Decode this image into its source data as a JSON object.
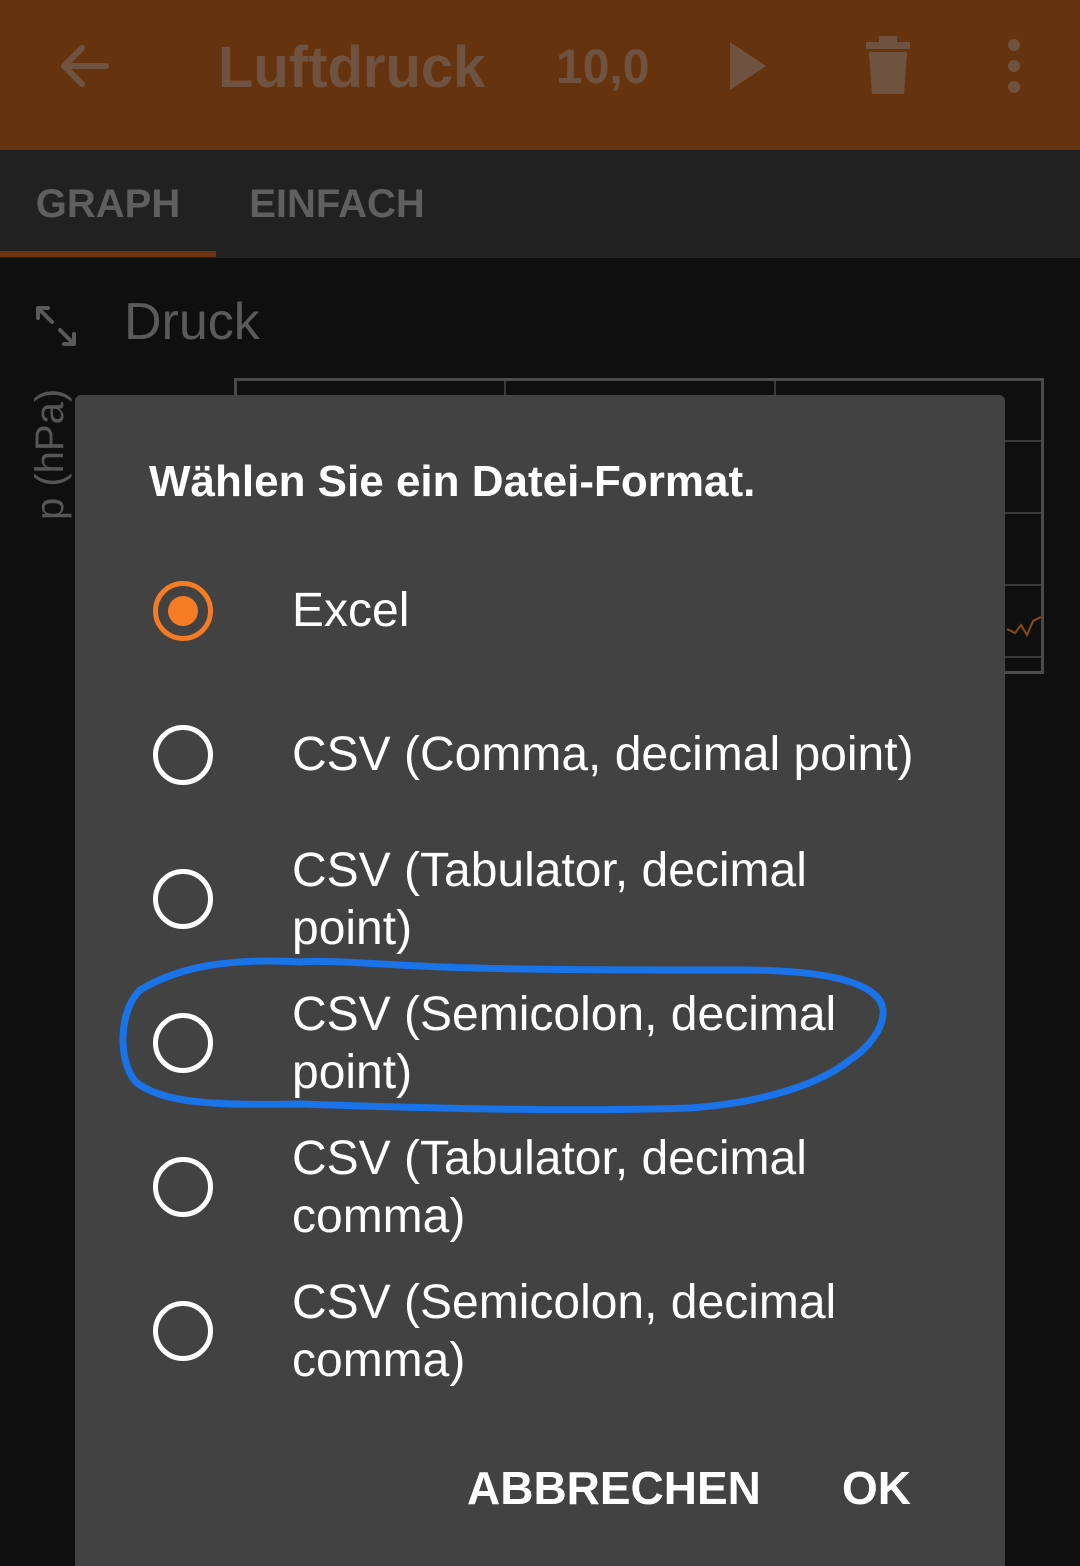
{
  "app_bar": {
    "title": "Luftdruck",
    "rate": "10,0",
    "icons": [
      "back-arrow-icon",
      "play-icon",
      "trash-icon",
      "more-vert-icon"
    ],
    "color": "#66330f"
  },
  "tabs": [
    {
      "label": "GRAPH",
      "selected": true
    },
    {
      "label": "EINFACH",
      "selected": false
    }
  ],
  "panel": {
    "title": "Druck",
    "y_axis_label": "p (hPa)"
  },
  "dialog": {
    "title": "Wählen Sie ein Datei-Format.",
    "options": [
      {
        "label": "Excel",
        "selected": true
      },
      {
        "label": "CSV (Comma, decimal point)",
        "selected": false
      },
      {
        "label": "CSV (Tabulator, decimal point)",
        "selected": false
      },
      {
        "label": "CSV (Semicolon, decimal point)",
        "selected": false,
        "highlighted": true
      },
      {
        "label": "CSV (Tabulator, decimal comma)",
        "selected": false
      },
      {
        "label": "CSV (Semicolon, decimal comma)",
        "selected": false
      }
    ],
    "cancel_label": "ABBRECHEN",
    "ok_label": "OK"
  },
  "colors": {
    "accent": "#f57c24",
    "annotation": "#1a73e8",
    "dialog_bg": "#424242"
  }
}
